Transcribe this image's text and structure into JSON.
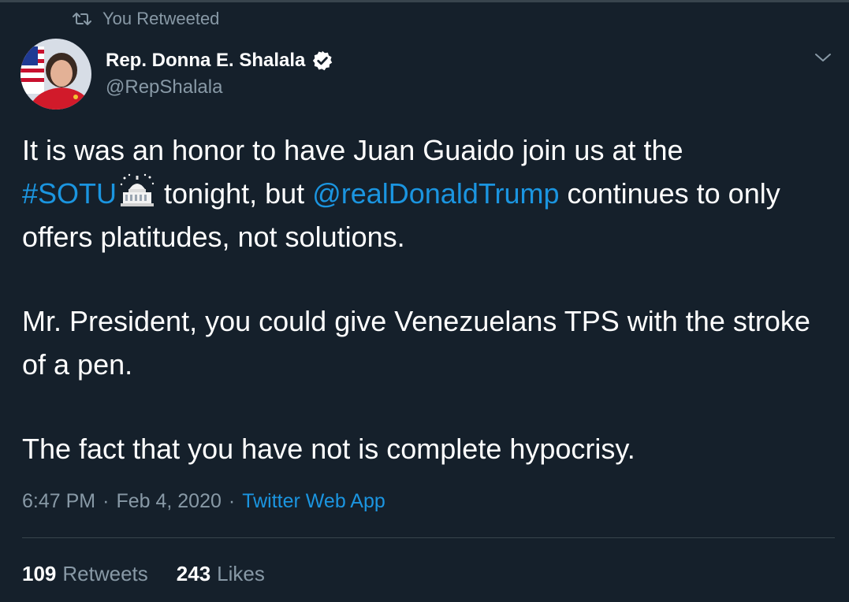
{
  "social_context": {
    "icon": "retweet-icon",
    "text": "You Retweeted"
  },
  "author": {
    "name": "Rep. Donna E. Shalala",
    "handle": "@RepShalala",
    "verified_icon": "verified-badge-icon"
  },
  "tweet": {
    "p1_a": "It is was an honor to have Juan Guaido join us at the",
    "hashtag": "#SOTU",
    "emoji": "capitol-building-emoji",
    "p1_b": "tonight, but",
    "mention": "@realDonaldTrump",
    "p1_c": "continues to only offers platitudes, not solutions.",
    "p2": "Mr. President, you could give Venezuelans TPS with the stroke of a pen.",
    "p3": "The fact that you have not is complete hypocrisy."
  },
  "meta": {
    "time": "6:47 PM",
    "sep": "·",
    "date": "Feb 4, 2020",
    "source": "Twitter Web App"
  },
  "stats": {
    "retweets_count": "109",
    "retweets_label": "Retweets",
    "likes_count": "243",
    "likes_label": "Likes"
  },
  "colors": {
    "background": "#15202b",
    "link": "#1b95e0",
    "secondary_text": "#8899a6",
    "divider": "#38444d"
  }
}
